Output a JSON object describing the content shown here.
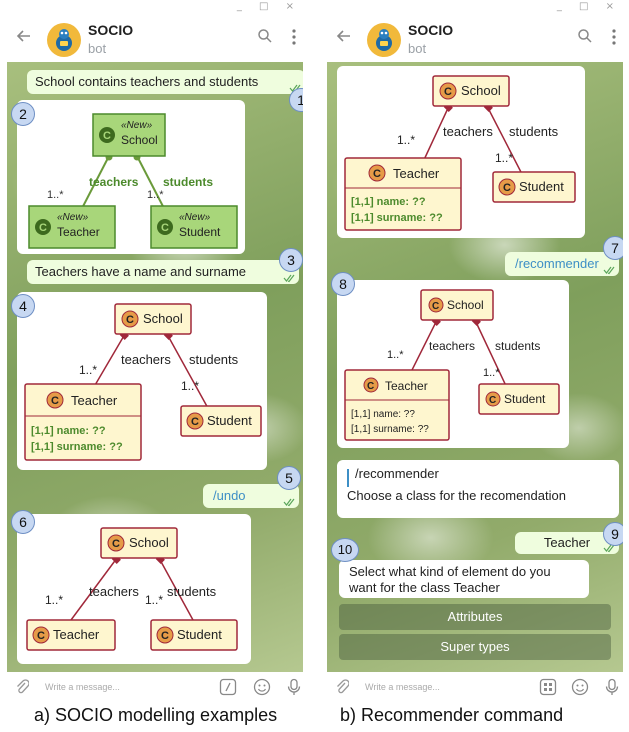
{
  "window_controls": "_ □ ×",
  "bot": {
    "name": "SOCIO",
    "subtitle": "bot"
  },
  "input_placeholder": "Write a message...",
  "panel_a": {
    "caption": "a) SOCIO modelling examples",
    "messages": {
      "m1": "School contains teachers and students",
      "m3": "Teachers have a name and surname",
      "m5": "/undo"
    },
    "diagram2": {
      "new_tag": "«New»",
      "school": "School",
      "teacher": "Teacher",
      "student": "Student",
      "teachers": "teachers",
      "students": "students",
      "mult": "1..*",
      "mult2": "1..*"
    },
    "diagram4": {
      "school": "School",
      "teacher": "Teacher",
      "student": "Student",
      "teachers": "teachers",
      "students": "students",
      "mult": "1..*",
      "mult2": "1..*",
      "attr1": "[1,1] name: ??",
      "attr2": "[1,1] surname: ??"
    },
    "diagram6": {
      "school": "School",
      "teacher": "Teacher",
      "student": "Student",
      "teachers": "teachers",
      "students": "students",
      "mult": "1..*",
      "mult2": "1..*"
    }
  },
  "panel_b": {
    "caption": "b) Recommender command",
    "messages": {
      "m7": "/recommender",
      "reply_quote": "/recommender",
      "reply_text": "Choose a class for the recomendation",
      "m9": "Teacher",
      "m10": "Select what kind of element do you want for the class Teacher"
    },
    "buttons": [
      "Attributes",
      "Super types"
    ],
    "diagram_top": {
      "school": "School",
      "teacher": "Teacher",
      "student": "Student",
      "teachers": "teachers",
      "students": "students",
      "mult": "1..*",
      "mult2": "1..*",
      "attr1": "[1,1] name: ??",
      "attr2": "[1,1] surname: ??"
    },
    "diagram8": {
      "school": "School",
      "teacher": "Teacher",
      "student": "Student",
      "teachers": "teachers",
      "students": "students",
      "mult": "1..*",
      "mult2": "1..*",
      "attr1": "[1,1] name: ??",
      "attr2": "[1,1] surname: ??"
    }
  },
  "step_numbers": [
    "1",
    "2",
    "3",
    "4",
    "5",
    "6",
    "7",
    "8",
    "9",
    "10"
  ],
  "colors": {
    "new_class_fill": "#a8d67a",
    "class_fill": "#fef6cf",
    "class_border": "#a0283a",
    "stereotype_circle": "#e69b48",
    "outgoing_bubble": "#effdde",
    "link": "#3d8fc6"
  },
  "icons": [
    "back-arrow-icon",
    "search-icon",
    "more-vertical-icon",
    "attach-icon",
    "slash-command-icon",
    "keyboard-icon",
    "emoji-icon",
    "microphone-icon",
    "double-check-icon"
  ]
}
